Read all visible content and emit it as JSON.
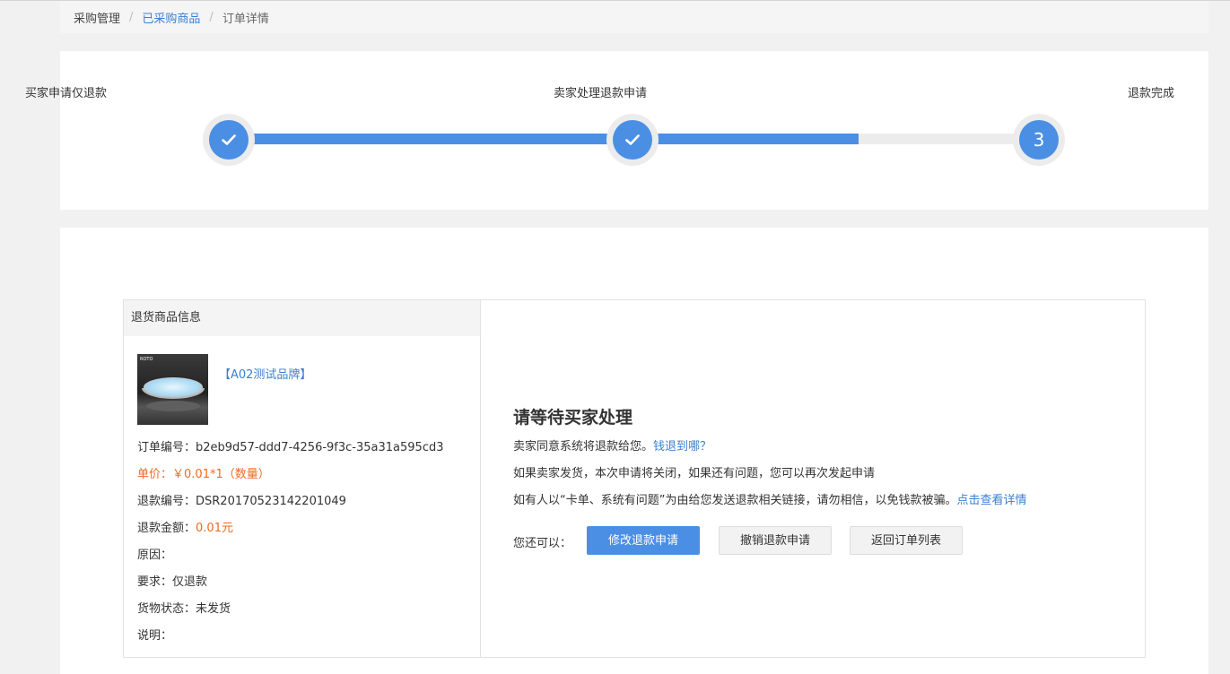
{
  "breadcrumb": {
    "items": [
      "采购管理",
      "已采购商品",
      "订单详情"
    ],
    "separator": "/"
  },
  "steps": {
    "labels": [
      "买家申请仅退款",
      "卖家处理退款申请",
      "退款完成"
    ],
    "current_number": "3",
    "completed_icon": "check-icon",
    "progress_percent": 78
  },
  "product": {
    "section_title": "退货商品信息",
    "brand": "【A02测试品牌】",
    "order_no_label": "订单编号：",
    "order_no": "b2eb9d57-ddd7-4256-9f3c-35a31a595cd3",
    "price_label": "单价：",
    "price": "￥0.01*1（数量）",
    "refund_no_label": "退款编号：",
    "refund_no": "DSR20170523142201049",
    "refund_amount_label": "退款金额：",
    "refund_amount": "0.01元",
    "reason_label": "原因：",
    "reason": "",
    "request_label": "要求：",
    "request": "仅退款",
    "status_label": "货物状态：",
    "status": "未发货",
    "note_label": "说明：",
    "note": "",
    "image_brand": "ROTO"
  },
  "status_panel": {
    "title": "请等待买家处理",
    "line1": "卖家同意系统将退款给您。",
    "line1_link": "钱退到哪？",
    "line2": "如果卖家发货，本次申请将关闭，如果还有问题，您可以再次发起申请",
    "line3": "如有人以“卡单、系统有问题”为由给您发送退款相关链接，请勿相信，以免钱款被骗。",
    "line3_link": "点击查看详情",
    "actions_label": "您还可以：",
    "buttons": {
      "modify": "修改退款申请",
      "cancel": "撤销退款申请",
      "back": "返回订单列表"
    }
  },
  "colors": {
    "accent": "#4a8fe4",
    "link": "#3b7fd0",
    "price": "#f06a1f"
  }
}
